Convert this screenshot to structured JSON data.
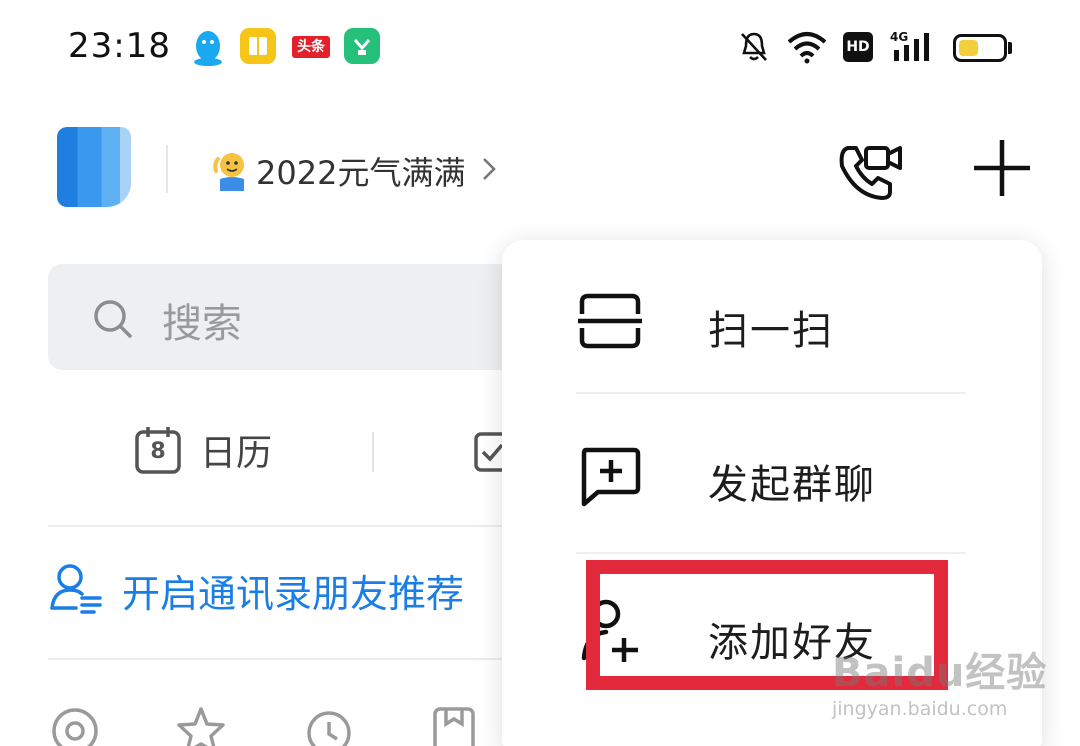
{
  "status_bar": {
    "time": "23:18",
    "app_icons": [
      "qq-penguin-icon",
      "reader-book-icon",
      "toutiao-icon",
      "green-shop-icon"
    ],
    "toutiao_label": "头条",
    "right_icons": [
      "mute-bell-icon",
      "wifi-icon",
      "hd-icon",
      "4g-signal-icon",
      "battery-icon"
    ],
    "hd_label": "HD",
    "network_label": "4G",
    "battery_level": 0.45,
    "battery_color": "#f3cf3c"
  },
  "header": {
    "status_text": "2022元气满满",
    "status_emoji": "waving-person-emoji",
    "video_call_icon": "video-call-icon",
    "plus_icon": "plus-icon"
  },
  "search": {
    "placeholder": "搜索"
  },
  "shortcuts": {
    "calendar_day": "8",
    "calendar_label": "日历"
  },
  "contacts_recommend": {
    "text": "开启通讯录朋友推荐"
  },
  "bottom_icons": [
    "at-icon",
    "star-icon",
    "clock-icon",
    "bookmark-icon"
  ],
  "popup_menu": {
    "items": [
      {
        "icon": "scan-icon",
        "label": "扫一扫"
      },
      {
        "icon": "group-chat-icon",
        "label": "发起群聊"
      },
      {
        "icon": "add-friend-icon",
        "label": "添加好友"
      }
    ],
    "highlight_color": "#e22a3c"
  },
  "watermark": {
    "brand": "Baidu经验",
    "url": "jingyan.baidu.com"
  },
  "colors": {
    "accent": "#1a7ee6",
    "search_bg": "#eeeff1"
  }
}
